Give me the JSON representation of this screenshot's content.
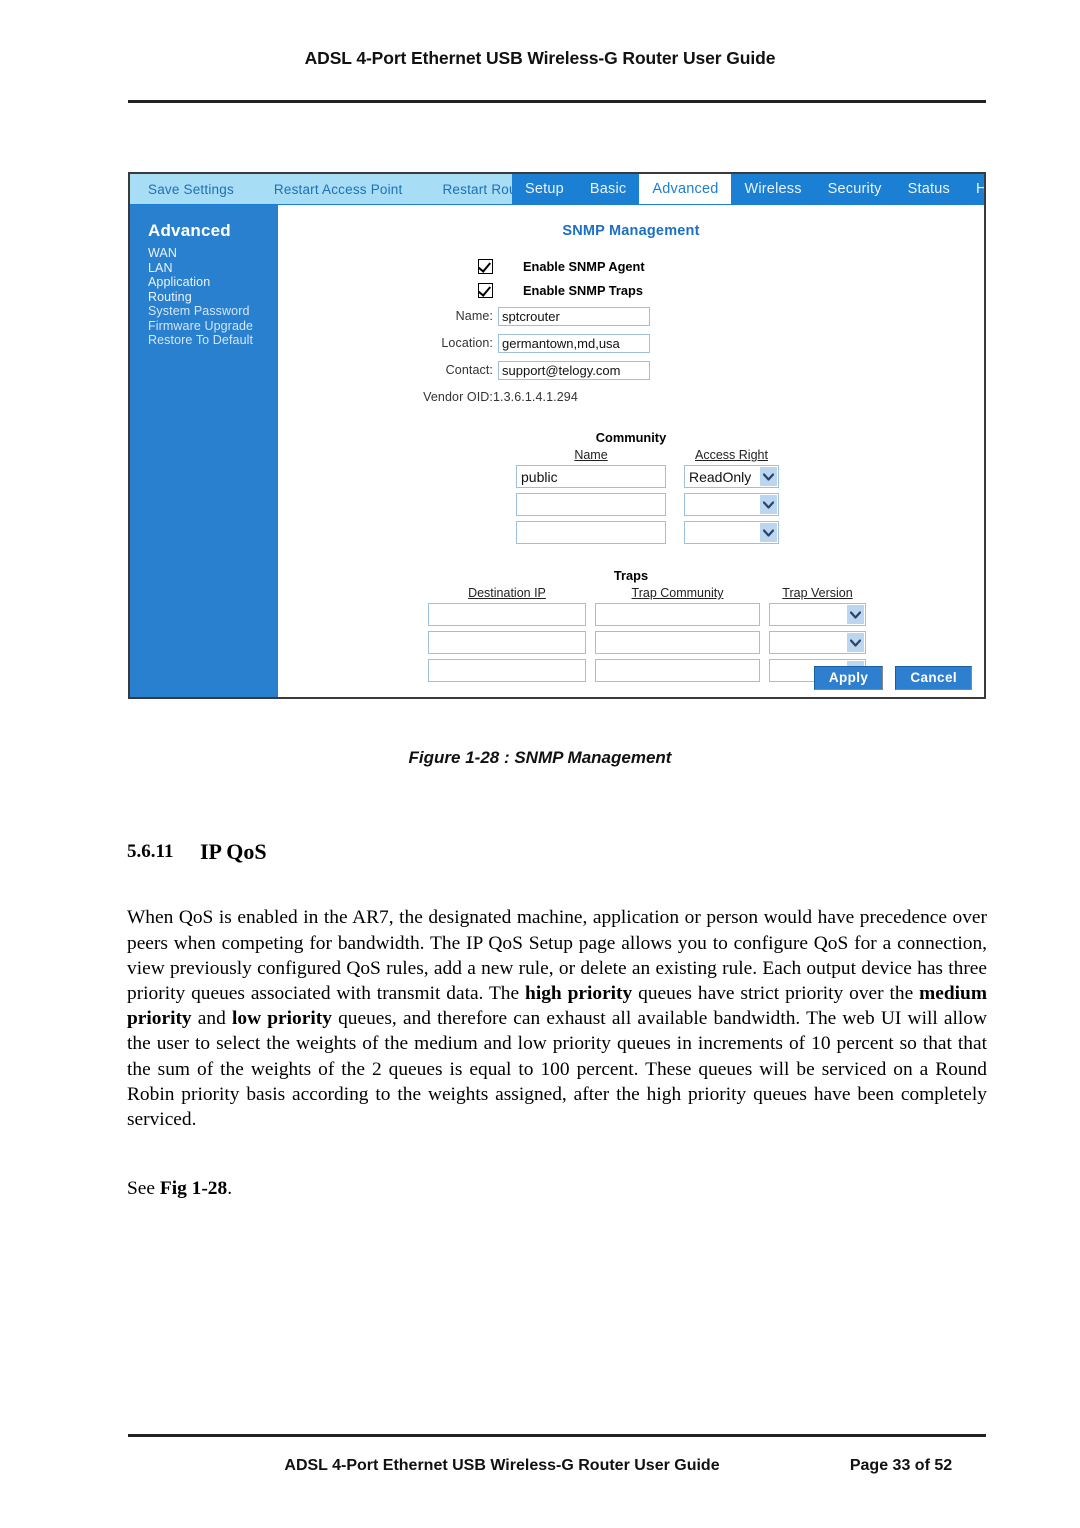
{
  "document": {
    "header_title": "ADSL 4-Port Ethernet USB Wireless-G Router User Guide",
    "footer_title": "ADSL 4-Port Ethernet USB Wireless-G Router User Guide",
    "footer_page": "Page 33 of 52",
    "figure_caption": "Figure 1-28 : SNMP Management",
    "section_number": "5.6.11",
    "section_title": "IP QoS",
    "paragraph_1": "When QoS is enabled in the AR7, the designated machine, application or person would have precedence over peers when competing for bandwidth. The IP QoS Setup page allows you to configure QoS for a connection, view previously configured QoS rules, add a new rule, or delete an existing rule. Each output device has three priority queues associated with transmit data. The ",
    "paragraph_1_b1": "high priority",
    "paragraph_1_mid1": " queues have strict priority over the ",
    "paragraph_1_b2": "medium priority",
    "paragraph_1_mid2": " and ",
    "paragraph_1_b3": "low priority",
    "paragraph_1_tail": " queues, and therefore can exhaust all available bandwidth. The web UI will allow the user to select the weights of the medium and low priority queues in increments of 10 percent so that that the sum of the weights of the 2 queues is equal to 100 percent. These queues will be serviced on a Round Robin priority basis according to the weights assigned, after the high priority queues have been completely serviced.",
    "paragraph_2_pre": "See ",
    "paragraph_2_b": "Fig 1-28",
    "paragraph_2_post": "."
  },
  "screenshot": {
    "nav_actions": [
      {
        "label": "Save Settings"
      },
      {
        "label": "Restart Access Point"
      },
      {
        "label": "Restart Router"
      }
    ],
    "nav_tabs": [
      {
        "label": "Setup",
        "active": false
      },
      {
        "label": "Basic",
        "active": false
      },
      {
        "label": "Advanced",
        "active": true
      },
      {
        "label": "Wireless",
        "active": false
      },
      {
        "label": "Security",
        "active": false
      },
      {
        "label": "Status",
        "active": false
      },
      {
        "label": "Help",
        "active": false
      }
    ],
    "sidebar": {
      "title": "Advanced",
      "items": [
        {
          "label": "WAN"
        },
        {
          "label": "LAN"
        },
        {
          "label": "Application"
        },
        {
          "label": "Routing"
        },
        {
          "label": "System Password"
        },
        {
          "label": "Firmware Upgrade"
        },
        {
          "label": "Restore To Default"
        }
      ]
    },
    "panel": {
      "title": "SNMP Management",
      "checkboxes": [
        {
          "label": "Enable SNMP Agent",
          "checked": true
        },
        {
          "label": "Enable SNMP Traps",
          "checked": true
        }
      ],
      "fields": [
        {
          "label": "Name:",
          "value": "sptcrouter"
        },
        {
          "label": "Location:",
          "value": "germantown,md,usa"
        },
        {
          "label": "Contact:",
          "value": "support@telogy.com"
        }
      ],
      "vendor_oid_label": "Vendor OID:",
      "vendor_oid_value": "1.3.6.1.4.1.294",
      "community": {
        "heading": "Community",
        "col_name": "Name",
        "col_access": "Access Right",
        "rows": [
          {
            "name": "public",
            "access": "ReadOnly"
          },
          {
            "name": "",
            "access": ""
          },
          {
            "name": "",
            "access": ""
          }
        ]
      },
      "traps": {
        "heading": "Traps",
        "col_dest": "Destination IP",
        "col_community": "Trap Community",
        "col_version": "Trap Version",
        "rows": [
          {
            "dest": "",
            "community": "",
            "version": ""
          },
          {
            "dest": "",
            "community": "",
            "version": ""
          },
          {
            "dest": "",
            "community": "",
            "version": ""
          }
        ]
      },
      "apply_label": "Apply",
      "cancel_label": "Cancel"
    },
    "colors": {
      "nav_bar": "#1b7fd4",
      "nav_left": "#a8ddf6",
      "sidebar": "#2980cf",
      "panel_title": "#1b6fc4",
      "button": "#2f7fd1"
    }
  }
}
